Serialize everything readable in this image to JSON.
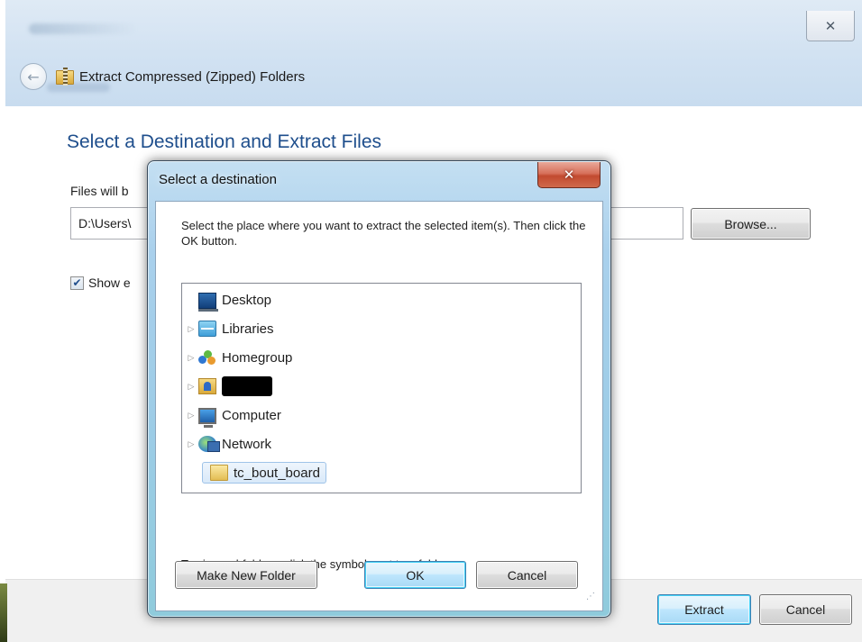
{
  "outer": {
    "title": "Extract Compressed (Zipped) Folders",
    "close_glyph": "✕",
    "back_glyph": "←",
    "heading": "Select a Destination and Extract Files",
    "files_label": "Files will b",
    "path_value": "D:\\Users\\",
    "browse_label": "Browse...",
    "show_label": "Show e",
    "show_checked": true,
    "extract_label": "Extract",
    "cancel_label": "Cancel"
  },
  "dialog": {
    "title": "Select a destination",
    "close_glyph": "✕",
    "instructions": "Select the place where you want to extract the selected item(s).  Then click the OK button.",
    "tree": [
      {
        "label": "Desktop",
        "icon": "desktop-icon",
        "expandable": false
      },
      {
        "label": "Libraries",
        "icon": "libraries-icon",
        "expandable": true
      },
      {
        "label": "Homegroup",
        "icon": "homegroup-icon",
        "expandable": true
      },
      {
        "label": "",
        "icon": "user-folder-icon",
        "expandable": true,
        "redacted": true
      },
      {
        "label": "Computer",
        "icon": "computer-icon",
        "expandable": true
      },
      {
        "label": "Network",
        "icon": "network-icon",
        "expandable": true
      },
      {
        "label": "tc_bout_board",
        "icon": "folder-icon",
        "expandable": false,
        "selected": true
      }
    ],
    "hint": "To view subfolders, click the symbol next to a folder.",
    "make_folder_label": "Make New Folder",
    "ok_label": "OK",
    "cancel_label": "Cancel"
  },
  "colors": {
    "heading": "#1e4e8c",
    "dialog_frame": "#a9d0ec",
    "close_red": "#c24a2f",
    "selection": "#d9e9f9"
  }
}
